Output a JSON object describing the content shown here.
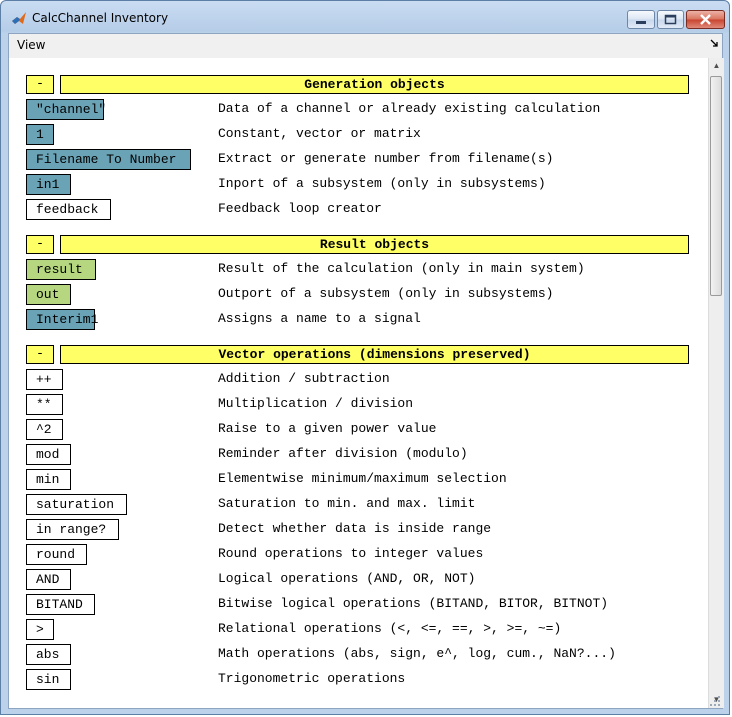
{
  "window": {
    "title": "CalcChannel Inventory",
    "minimize_symbol": "—",
    "maximize_symbol": "☐",
    "close_symbol": "✕"
  },
  "menubar": {
    "view_label": "View"
  },
  "sections": [
    {
      "toggle_label": "-",
      "header": "Generation objects",
      "items": [
        {
          "block": "\"channel\"",
          "description": "Data of a channel or already existing calculation",
          "style": "blue",
          "width": 78
        },
        {
          "block": "1",
          "description": "Constant, vector or matrix",
          "style": "blue",
          "width": 28
        },
        {
          "block": "Filename To Number",
          "description": "Extract or generate number from filename(s)",
          "style": "blue",
          "width": 165
        },
        {
          "block": "in1",
          "description": "Inport of a subsystem (only in subsystems)",
          "style": "blue",
          "width": 45
        },
        {
          "block": "feedback",
          "description": "Feedback loop creator",
          "style": "white",
          "width": 85
        }
      ]
    },
    {
      "toggle_label": "-",
      "header": "Result objects",
      "items": [
        {
          "block": "result",
          "description": "Result of the calculation (only in main system)",
          "style": "green",
          "width": 70
        },
        {
          "block": "out",
          "description": "Outport of a subsystem (only in subsystems)",
          "style": "green",
          "width": 45
        },
        {
          "block": "Interim1",
          "description": "Assigns a name to a signal",
          "style": "blue",
          "width": 69
        }
      ]
    },
    {
      "toggle_label": "-",
      "header": "Vector operations (dimensions preserved)",
      "items": [
        {
          "block": "++",
          "description": "Addition / subtraction",
          "style": "white",
          "width": 37
        },
        {
          "block": "**",
          "description": "Multiplication / division",
          "style": "white",
          "width": 37
        },
        {
          "block": "^2",
          "description": "Raise to a given power value",
          "style": "white",
          "width": 37
        },
        {
          "block": "mod",
          "description": "Reminder after division (modulo)",
          "style": "white",
          "width": 45
        },
        {
          "block": "min",
          "description": "Elementwise minimum/maximum selection",
          "style": "white",
          "width": 45
        },
        {
          "block": "saturation",
          "description": "Saturation to min. and max. limit",
          "style": "white",
          "width": 101
        },
        {
          "block": "in range?",
          "description": "Detect whether data is inside range",
          "style": "white",
          "width": 93
        },
        {
          "block": "round",
          "description": "Round operations to integer values",
          "style": "white",
          "width": 61
        },
        {
          "block": "AND",
          "description": "Logical operations (AND, OR, NOT)",
          "style": "white",
          "width": 45
        },
        {
          "block": "BITAND",
          "description": "Bitwise logical operations (BITAND, BITOR, BITNOT)",
          "style": "white",
          "width": 69
        },
        {
          "block": ">",
          "description": "Relational operations (<, <=, ==, >, >=, ~=)",
          "style": "white",
          "width": 28
        },
        {
          "block": "abs",
          "description": "Math operations (abs, sign, e^, log, cum., NaN?...)",
          "style": "white",
          "width": 45
        },
        {
          "block": "sin",
          "description": "Trigonometric operations",
          "style": "white",
          "width": 45
        }
      ]
    }
  ],
  "colors": {
    "section_header": "#ffff66",
    "block_blue": "#6ba3b6",
    "block_green": "#b6d77f",
    "block_white": "#ffffff"
  }
}
